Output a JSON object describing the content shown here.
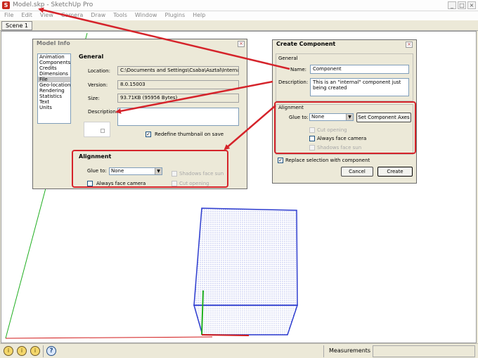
{
  "app": {
    "title": "Model.skp - SketchUp Pro",
    "menu": [
      "File",
      "Edit",
      "View",
      "Camera",
      "Draw",
      "Tools",
      "Window",
      "Plugins",
      "Help"
    ],
    "scene_tab": "Scene 1",
    "window_buttons": {
      "minimize": "_",
      "maximize": "□",
      "close": "×"
    }
  },
  "model_info": {
    "title": "Model Info",
    "close_glyph": "×",
    "nav_items": [
      "Animation",
      "Components",
      "Credits",
      "Dimensions",
      "File",
      "Geo-location",
      "Rendering",
      "Statistics",
      "Text",
      "Units"
    ],
    "selected_nav": "File",
    "general_heading": "General",
    "location_label": "Location:",
    "location_value": "C:\\Documents and Settings\\Csaba\\Asztal\\Internal-e",
    "version_label": "Version:",
    "version_value": "8.0.15003",
    "size_label": "Size:",
    "size_value": "93.71KB (95956 Bytes)",
    "description_label": "Description:",
    "description_value": "",
    "redefine_label": "Redefine thumbnail on save",
    "redefine_checked": true,
    "alignment_heading": "Alignment",
    "glue_label": "Glue to:",
    "glue_value": "None",
    "shadows_label": "Shadows face sun",
    "face_camera_label": "Always face camera",
    "cut_opening_label": "Cut opening"
  },
  "create_component": {
    "title": "Create Component",
    "close_glyph": "×",
    "general_heading": "General",
    "name_label": "Name:",
    "name_value": "Component",
    "description_label": "Description:",
    "description_value": "This is an \"internal\" component just being created",
    "alignment_heading": "Alignment",
    "glue_label": "Glue to:",
    "glue_value": "None",
    "set_axes_label": "Set Component Axes",
    "cut_opening_label": "Cut opening",
    "face_camera_label": "Always face camera",
    "shadows_label": "Shadows face sun",
    "replace_label": "Replace selection with component",
    "replace_checked": true,
    "cancel_label": "Cancel",
    "create_label": "Create"
  },
  "status_bar": {
    "icons": [
      "i",
      "i",
      "i"
    ],
    "help_glyph": "?",
    "measurements_label": "Measurements",
    "measurements_value": ""
  },
  "colors": {
    "annotation": "#d5232a",
    "cube_edge": "#2d3ccf",
    "axis_green": "#1fae1f",
    "axis_red": "#d21a1a"
  }
}
